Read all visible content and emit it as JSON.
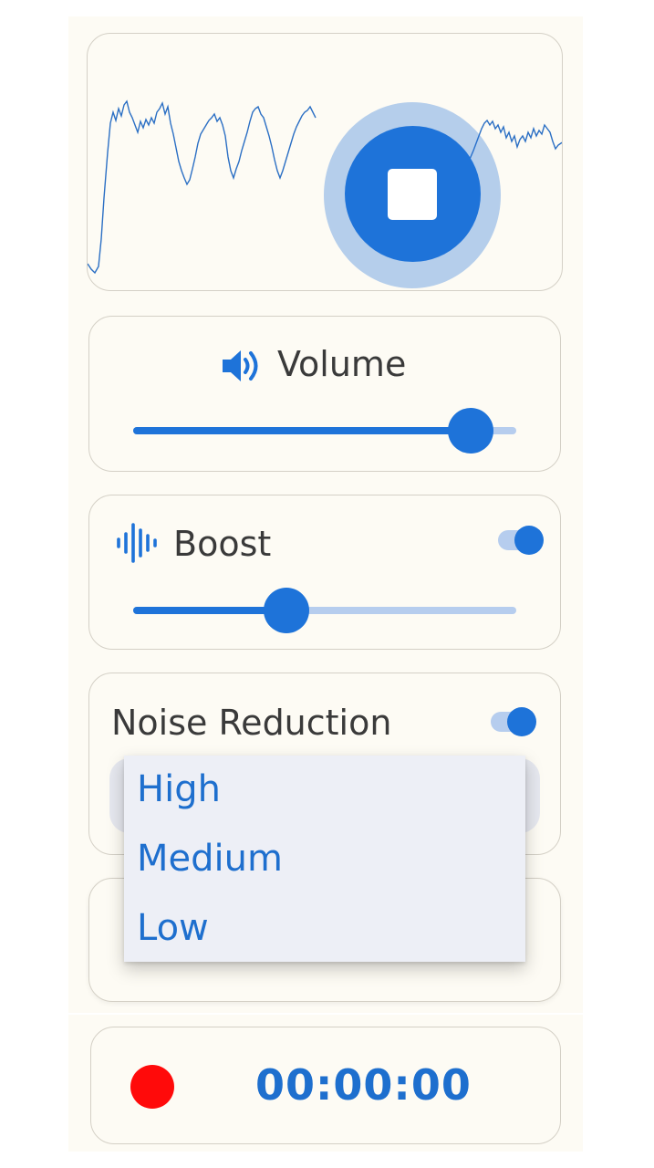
{
  "visualizer": {
    "stop_icon": "stop-icon"
  },
  "volume": {
    "icon": "speaker-volume-icon",
    "title": "Volume",
    "level": 0.88
  },
  "boost": {
    "icon": "sound-wave-icon",
    "title": "Boost",
    "enabled": true,
    "level": 0.4
  },
  "noise_reduction": {
    "title": "Noise Reduction",
    "enabled": true,
    "options": [
      "High",
      "Medium",
      "Low"
    ]
  },
  "recorder": {
    "timer": "00:00:00"
  },
  "colors": {
    "accent": "#1e73d9",
    "accent_light": "#b6cdee",
    "record": "#ff0a0a",
    "background": "#fdfbf4"
  }
}
